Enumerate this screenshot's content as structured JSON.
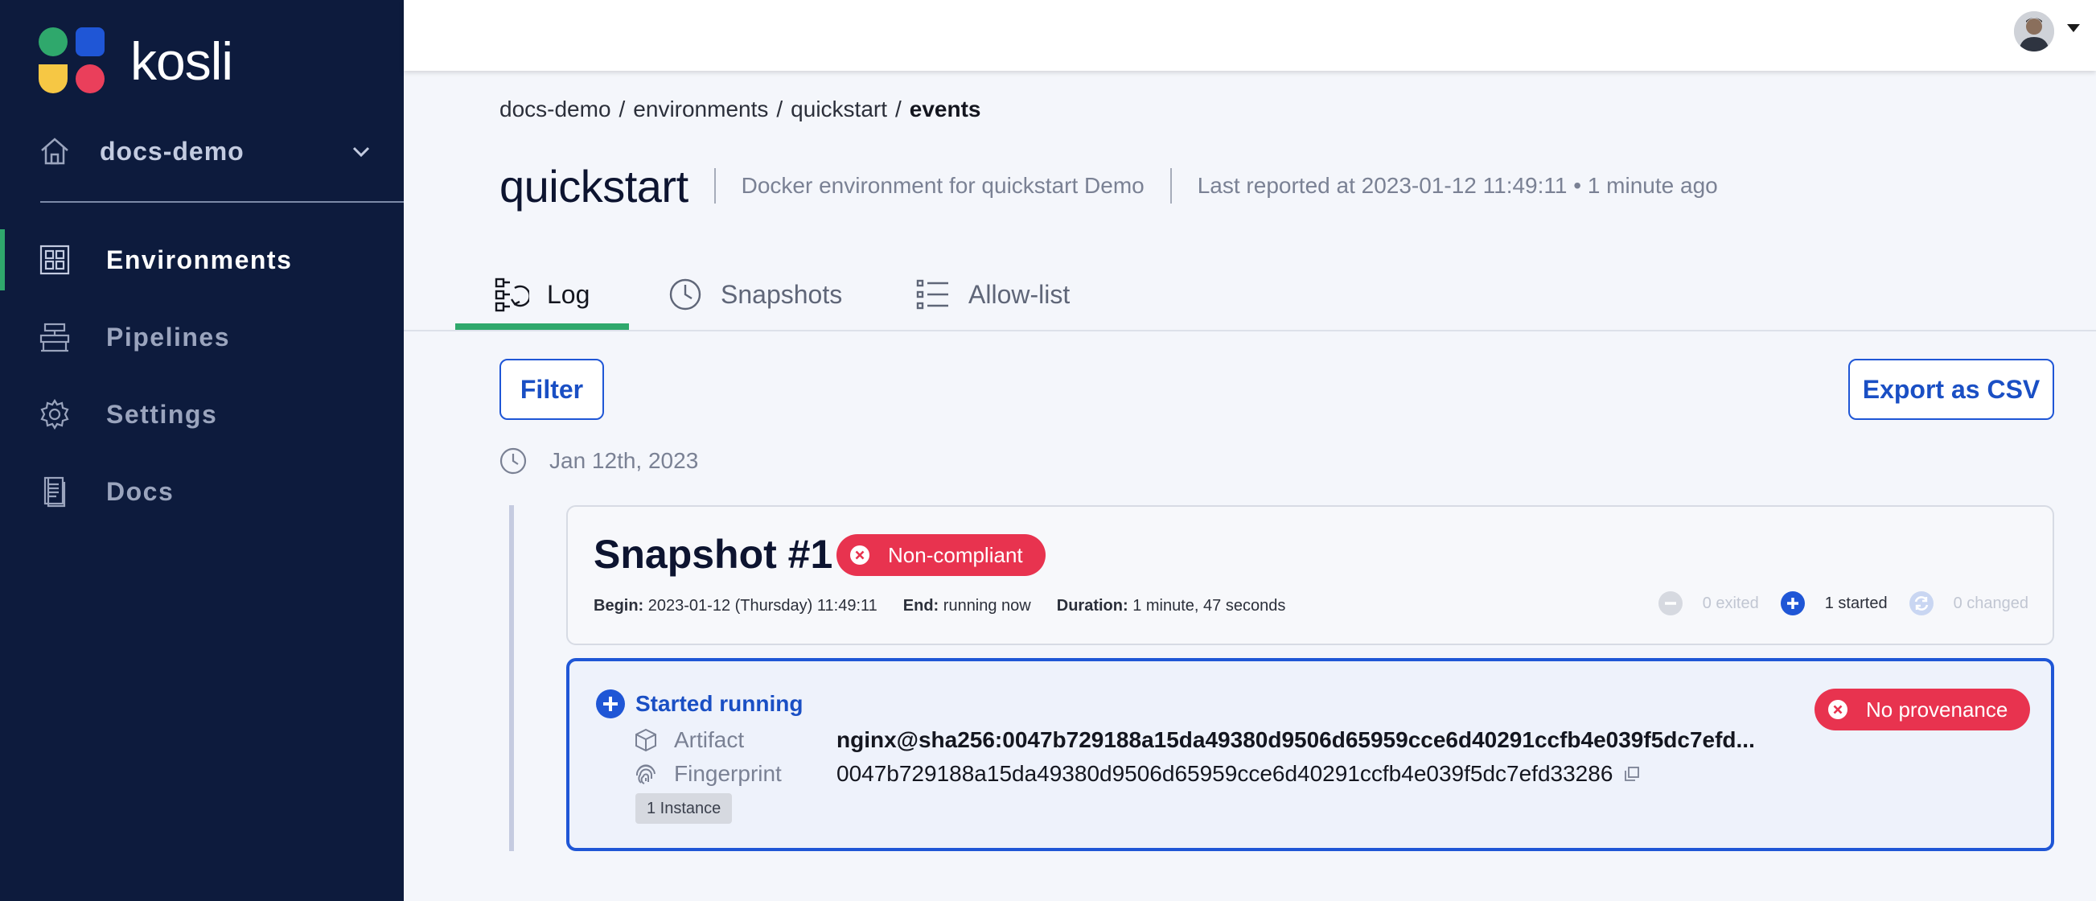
{
  "app": {
    "brand": "kosli",
    "brand_colors": {
      "sidebar": "#0d1b3d",
      "accent_green": "#2fa86c",
      "accent_blue": "#1f56d6",
      "danger": "#e8334f"
    }
  },
  "sidebar": {
    "org": "docs-demo",
    "items": [
      {
        "label": "Environments",
        "icon": "grid-icon",
        "active": true
      },
      {
        "label": "Pipelines",
        "icon": "pipeline-icon",
        "active": false
      },
      {
        "label": "Settings",
        "icon": "gear-icon",
        "active": false
      },
      {
        "label": "Docs",
        "icon": "document-icon",
        "active": false
      }
    ]
  },
  "breadcrumb": {
    "items": [
      "docs-demo",
      "environments",
      "quickstart"
    ],
    "current": "events",
    "separator": "/"
  },
  "header": {
    "title": "quickstart",
    "description": "Docker environment for quickstart Demo",
    "last_reported": "Last reported at 2023-01-12 11:49:11 • 1 minute ago"
  },
  "tabs": [
    {
      "label": "Log",
      "icon": "log-icon",
      "active": true
    },
    {
      "label": "Snapshots",
      "icon": "clock-icon",
      "active": false
    },
    {
      "label": "Allow-list",
      "icon": "list-icon",
      "active": false
    }
  ],
  "toolbar": {
    "filter_label": "Filter",
    "export_label": "Export as CSV"
  },
  "log": {
    "date": "Jan 12th, 2023",
    "snapshot": {
      "title": "Snapshot #1",
      "status": "Non-compliant",
      "begin_label": "Begin:",
      "begin_value": "2023-01-12 (Thursday) 11:49:11",
      "end_label": "End:",
      "end_value": "running now",
      "duration_label": "Duration:",
      "duration_value": "1 minute, 47 seconds",
      "counts": {
        "exited": "0 exited",
        "started": "1 started",
        "changed": "0 changed"
      }
    },
    "event": {
      "title": "Started running",
      "status": "No provenance",
      "artifact_label": "Artifact",
      "artifact_value": "nginx@sha256:0047b729188a15da49380d9506d65959cce6d40291ccfb4e039f5dc7efd...",
      "fingerprint_label": "Fingerprint",
      "fingerprint_value": "0047b729188a15da49380d9506d65959cce6d40291ccfb4e039f5dc7efd33286",
      "instances": "1 Instance"
    }
  }
}
